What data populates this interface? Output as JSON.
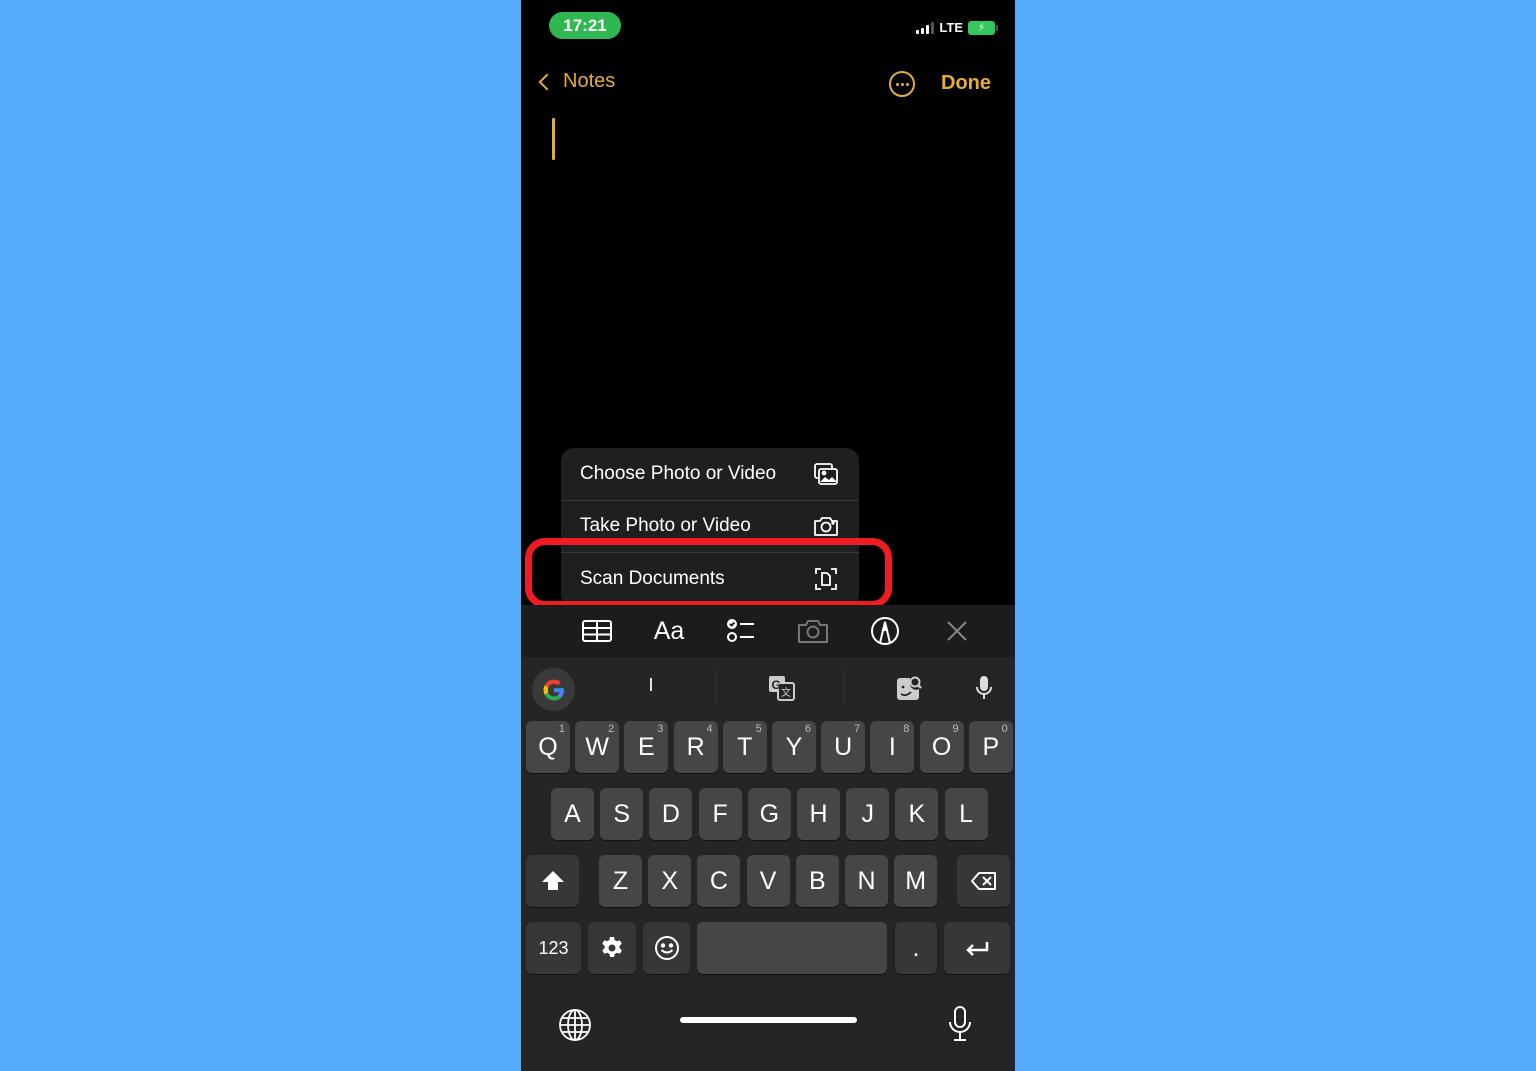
{
  "status_bar": {
    "time": "17:21",
    "network": "LTE",
    "battery_state": "charging",
    "signal_bars": 3
  },
  "nav": {
    "back_label": "Notes",
    "more_icon": "ellipsis-circle-icon",
    "done_label": "Done"
  },
  "colors": {
    "accent": "#e6ac3a",
    "background": "#56adfd",
    "highlight": "#ef1c23",
    "time_pill": "#2fb84f"
  },
  "menu": {
    "items": [
      {
        "label": "Choose Photo or Video",
        "icon": "photo-library-icon"
      },
      {
        "label": "Take Photo or Video",
        "icon": "camera-icon"
      },
      {
        "label": "Scan Documents",
        "icon": "scan-document-icon"
      }
    ],
    "highlighted": "Scan Documents"
  },
  "toolbar": {
    "format_label": "Aa",
    "items": [
      "table-icon",
      "format-text",
      "checklist-icon",
      "camera-icon",
      "markup-icon",
      "close-icon"
    ]
  },
  "keyboard": {
    "suggestion": "I",
    "row1": [
      {
        "k": "Q",
        "n": "1"
      },
      {
        "k": "W",
        "n": "2"
      },
      {
        "k": "E",
        "n": "3"
      },
      {
        "k": "R",
        "n": "4"
      },
      {
        "k": "T",
        "n": "5"
      },
      {
        "k": "Y",
        "n": "6"
      },
      {
        "k": "U",
        "n": "7"
      },
      {
        "k": "I",
        "n": "8"
      },
      {
        "k": "O",
        "n": "9"
      },
      {
        "k": "P",
        "n": "0"
      }
    ],
    "row2": [
      "A",
      "S",
      "D",
      "F",
      "G",
      "H",
      "J",
      "K",
      "L"
    ],
    "row3": [
      "Z",
      "X",
      "C",
      "V",
      "B",
      "N",
      "M"
    ],
    "numbers_label": "123",
    "period_label": "."
  }
}
